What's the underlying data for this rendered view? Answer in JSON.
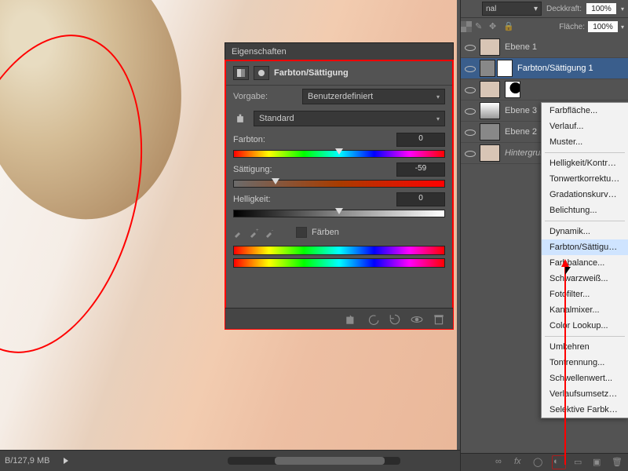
{
  "status": {
    "coords": "B/127,9 MB"
  },
  "properties": {
    "tab": "Eigenschaften",
    "title": "Farbton/Sättigung",
    "preset_label": "Vorgabe:",
    "preset_value": "Benutzerdefiniert",
    "range_value": "Standard",
    "hue": {
      "label": "Farbton:",
      "value": "0",
      "pos": 50
    },
    "sat": {
      "label": "Sättigung:",
      "value": "-59",
      "pos": 20
    },
    "lig": {
      "label": "Helligkeit:",
      "value": "0",
      "pos": 50
    },
    "colorize": "Färben"
  },
  "layers_panel": {
    "blend_mode": "nal",
    "opacity_label": "Deckkraft:",
    "opacity": "100%",
    "fill_label": "Fläche:",
    "fill": "100%",
    "layers": [
      {
        "name": "Ebene 1"
      },
      {
        "name": "Farbton/Sättigung 1"
      },
      {
        "name": ""
      },
      {
        "name": "Ebene 3"
      },
      {
        "name": "Ebene 2"
      },
      {
        "name": "Hintergrund"
      }
    ]
  },
  "menu": {
    "items1": [
      "Farbfläche...",
      "Verlauf...",
      "Muster..."
    ],
    "items2": [
      "Helligkeit/Kontrast...",
      "Tonwertkorrektur...",
      "Gradationskurven...",
      "Belichtung..."
    ],
    "items3": [
      "Dynamik...",
      "Farbton/Sättigung...",
      "Farbbalance...",
      "Schwarzweiß...",
      "Fotofilter...",
      "Kanalmixer...",
      "Color Lookup..."
    ],
    "items4": [
      "Umkehren",
      "Tontrennung...",
      "Schwellenwert...",
      "Verlaufsumsetzung...",
      "Selektive Farbkorrektur..."
    ]
  }
}
